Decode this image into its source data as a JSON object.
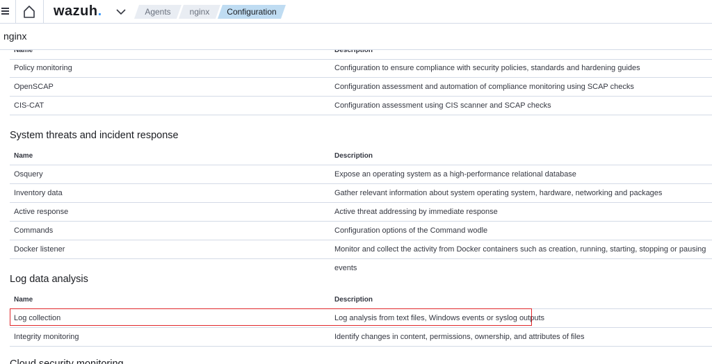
{
  "topbar": {
    "menu_icon": "hamburger-menu-icon",
    "home_icon": "home-icon",
    "logo": {
      "text": "wazuh",
      "dot": ".",
      "dot_color": "#3595f9"
    },
    "expand_icon": "chevron-down-icon",
    "breadcrumbs": [
      {
        "label": "Agents",
        "active": false
      },
      {
        "label": "nginx",
        "active": false
      },
      {
        "label": "Configuration",
        "active": true
      }
    ]
  },
  "page": {
    "title": "nginx"
  },
  "sections": {
    "first": {
      "columns": {
        "name": "Name",
        "description": "Description"
      },
      "rows": [
        {
          "name": "Policy monitoring",
          "description": "Configuration to ensure compliance with security policies, standards and hardening guides"
        },
        {
          "name": "OpenSCAP",
          "description": "Configuration assessment and automation of compliance monitoring using SCAP checks"
        },
        {
          "name": "CIS-CAT",
          "description": "Configuration assessment using CIS scanner and SCAP checks"
        }
      ]
    },
    "threats": {
      "title": "System threats and incident response",
      "columns": {
        "name": "Name",
        "description": "Description"
      },
      "rows": [
        {
          "name": "Osquery",
          "description": "Expose an operating system as a high-performance relational database"
        },
        {
          "name": "Inventory data",
          "description": "Gather relevant information about system operating system, hardware, networking and packages"
        },
        {
          "name": "Active response",
          "description": "Active threat addressing by immediate response"
        },
        {
          "name": "Commands",
          "description": "Configuration options of the Command wodle"
        },
        {
          "name": "Docker listener",
          "description": "Monitor and collect the activity from Docker containers such as creation, running, starting, stopping or pausing events"
        }
      ]
    },
    "logs": {
      "title": "Log data analysis",
      "columns": {
        "name": "Name",
        "description": "Description"
      },
      "rows": [
        {
          "name": "Log collection",
          "description": "Log analysis from text files, Windows events or syslog outputs"
        },
        {
          "name": "Integrity monitoring",
          "description": "Identify changes in content, permissions, ownership, and attributes of files"
        }
      ]
    },
    "next": {
      "title": "Cloud security monitoring"
    }
  },
  "colors": {
    "highlight_border": "#e0272b",
    "active_crumb": "#bfdcf2"
  }
}
